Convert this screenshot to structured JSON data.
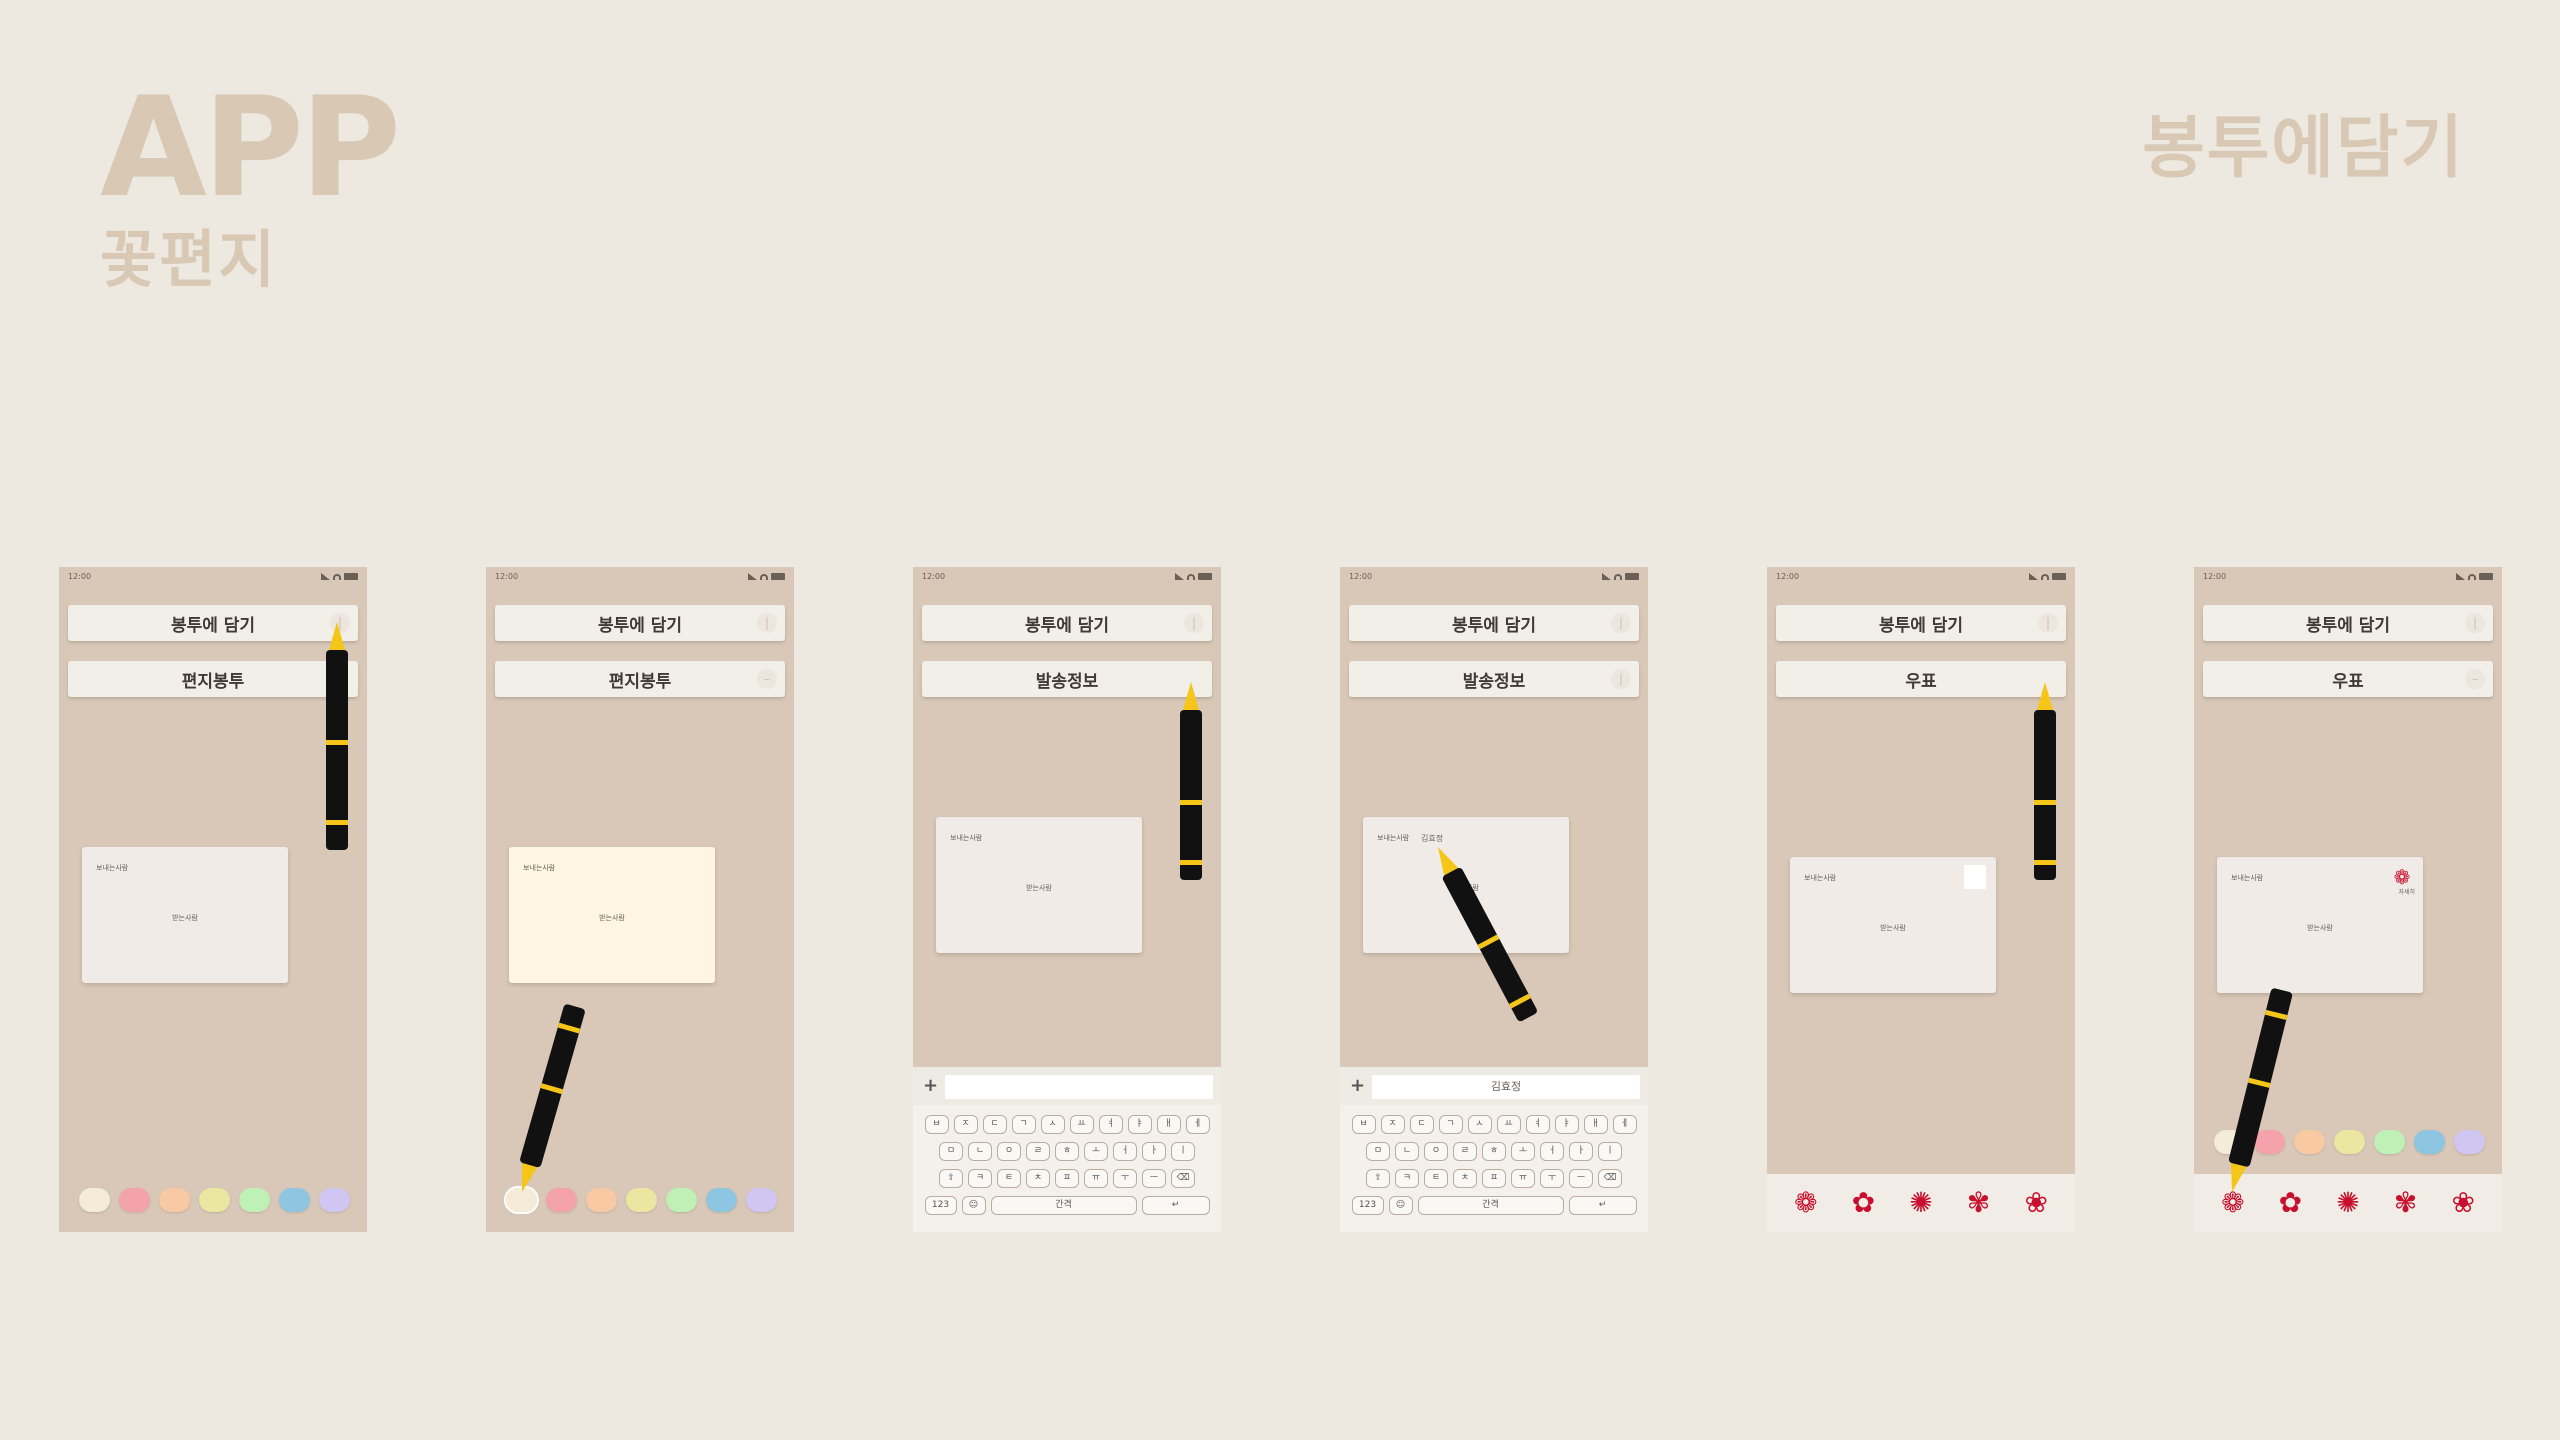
{
  "brand": {
    "app": "APP",
    "name": "꽃편지"
  },
  "section_title": "봉투에담기",
  "status_time": "12:00",
  "colors": {
    "background": "#ede9e0",
    "phone": "#d9c8b7",
    "swatches": [
      "#f4ecd7",
      "#f4a3ad",
      "#f8c9a3",
      "#ebe7a2",
      "#bff0b5",
      "#8ec5e0",
      "#cfc6f2"
    ],
    "stamp_red": "#c8102e"
  },
  "screens": [
    {
      "title": "봉투에 담기",
      "subtitle": "편지봉투",
      "envelope": {
        "from": "보내는사람",
        "to": "받는사람"
      },
      "panel": "swatches"
    },
    {
      "title": "봉투에 담기",
      "subtitle": "편지봉투",
      "envelope": {
        "from": "보내는사람",
        "to": "받는사람"
      },
      "panel": "swatches"
    },
    {
      "title": "봉투에 담기",
      "subtitle": "발송정보",
      "envelope": {
        "from": "보내는사람",
        "to": "받는사람"
      },
      "panel": "keyboard",
      "input_value": ""
    },
    {
      "title": "봉투에 담기",
      "subtitle": "발송정보",
      "envelope": {
        "from": "보내는사람",
        "to": "받는사람",
        "written": "김효정"
      },
      "panel": "keyboard",
      "input_value": "김효정"
    },
    {
      "title": "봉투에 담기",
      "subtitle": "우표",
      "envelope": {
        "from": "보내는사람",
        "to": "받는사람"
      },
      "panel": "stamps"
    },
    {
      "title": "봉투에 담기",
      "subtitle": "우표",
      "envelope": {
        "from": "보내는사람",
        "to": "받는사람",
        "stamp_label": "자세히"
      },
      "panel": "swatches+stamps"
    }
  ],
  "keyboard": {
    "row1": [
      "ㅂ",
      "ㅈ",
      "ㄷ",
      "ㄱ",
      "ㅅ",
      "ㅛ",
      "ㅕ",
      "ㅑ",
      "ㅐ",
      "ㅔ"
    ],
    "row2": [
      "ㅁ",
      "ㄴ",
      "ㅇ",
      "ㄹ",
      "ㅎ",
      "ㅗ",
      "ㅓ",
      "ㅏ",
      "ㅣ"
    ],
    "row3": [
      "⇧",
      "ㅋ",
      "ㅌ",
      "ㅊ",
      "ㅍ",
      "ㅠ",
      "ㅜ",
      "ㅡ",
      "⌫"
    ],
    "num_key": "123",
    "space_key": "간격",
    "enter_key": "↵"
  },
  "stamp_icons": [
    "rose-stamp-icon",
    "flower-stamp-icon",
    "sunburst-stamp-icon",
    "blossom-stamp-icon",
    "camellia-stamp-icon"
  ]
}
